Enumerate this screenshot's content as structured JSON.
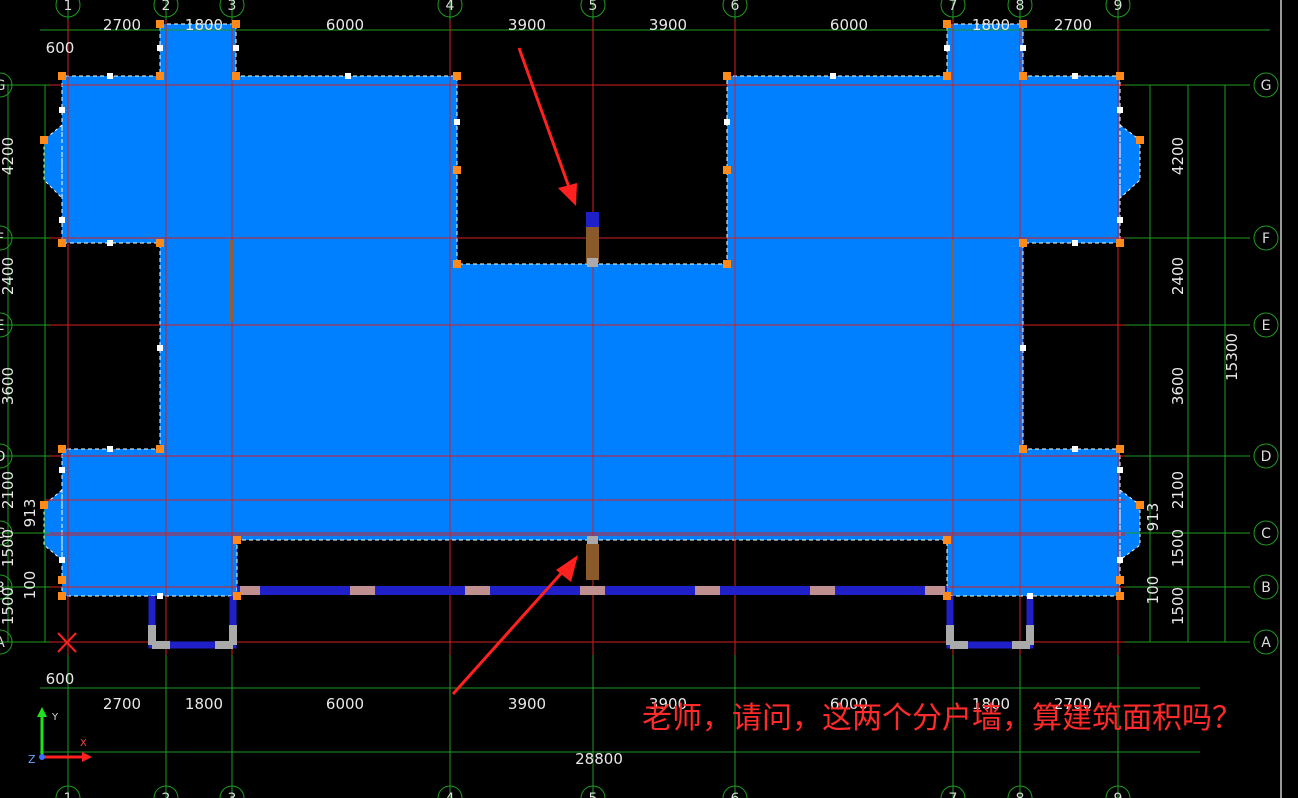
{
  "colors": {
    "fill": "#0080ff",
    "axis": "#d42020",
    "dimension": "#1f9a1f",
    "wall": "#2020c8",
    "arrow": "#ff2020",
    "annotation": "#ff2020"
  },
  "axes": {
    "vertical": [
      "1",
      "2",
      "3",
      "4",
      "5",
      "6",
      "7",
      "8",
      "9"
    ],
    "horizontal": [
      "G",
      "F",
      "E",
      "D",
      "C",
      "B",
      "A"
    ]
  },
  "dims": {
    "top": [
      "2700",
      "1800",
      "6000",
      "3900",
      "3900",
      "6000",
      "1800",
      "2700"
    ],
    "bottom": [
      "2700",
      "1800",
      "6000",
      "3900",
      "3900",
      "6000",
      "1800",
      "2700"
    ],
    "offset_top": "600",
    "offset_bottom": "600",
    "total": "28800",
    "left": [
      "4200",
      "2400",
      "3600",
      "2100",
      "1500",
      "1500"
    ],
    "left_extra": [
      "913",
      "100"
    ],
    "right": [
      "4200",
      "2400",
      "3600",
      "2100",
      "1500",
      "1500"
    ],
    "right_extra": [
      "913",
      "100"
    ],
    "right_total": "15300"
  },
  "ucs": {
    "x": "X",
    "y": "Y",
    "z": "Z"
  },
  "annotation": "老师，请问，这两个分户墙，算建筑面积吗？"
}
